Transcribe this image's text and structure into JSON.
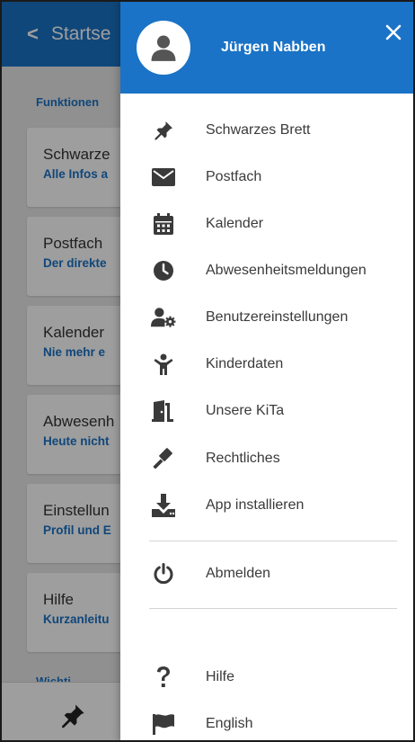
{
  "background": {
    "header_back": "<",
    "header_title": "Startse",
    "section_label": "Funktionen",
    "cards": [
      {
        "title": "Schwarze",
        "subtitle": "Alle Infos a"
      },
      {
        "title": "Postfach",
        "subtitle": "Der direkte"
      },
      {
        "title": "Kalender",
        "subtitle": "Nie mehr e"
      },
      {
        "title": "Abwesenh",
        "subtitle": "Heute nicht"
      },
      {
        "title": "Einstellun",
        "subtitle": "Profil und E"
      },
      {
        "title": "Hilfe",
        "subtitle": "Kurzanleitu"
      }
    ],
    "section_label_2": "Wichti",
    "bottom_icon": "pin-icon"
  },
  "drawer": {
    "user_name": "Jürgen Nabben",
    "avatar_icon": "user-avatar-icon",
    "close_icon": "close-icon",
    "menu": [
      {
        "label": "Schwarzes Brett",
        "icon": "pin-icon"
      },
      {
        "label": "Postfach",
        "icon": "envelope-icon"
      },
      {
        "label": "Kalender",
        "icon": "calendar-icon"
      },
      {
        "label": "Abwesenheitsmeldungen",
        "icon": "clock-icon"
      },
      {
        "label": "Benutzereinstellungen",
        "icon": "user-settings-icon"
      },
      {
        "label": "Kinderdaten",
        "icon": "child-icon"
      },
      {
        "label": "Unsere KiTa",
        "icon": "door-icon"
      },
      {
        "label": "Rechtliches",
        "icon": "gavel-icon"
      },
      {
        "label": "App installieren",
        "icon": "download-icon"
      }
    ],
    "logout": {
      "label": "Abmelden",
      "icon": "power-icon"
    },
    "footer": [
      {
        "label": "Hilfe",
        "icon": "question-icon"
      },
      {
        "label": "English",
        "icon": "flag-icon"
      }
    ]
  },
  "colors": {
    "primary": "#1a73c6",
    "icon": "#3a3a3a",
    "text": "#3a3a3a"
  }
}
